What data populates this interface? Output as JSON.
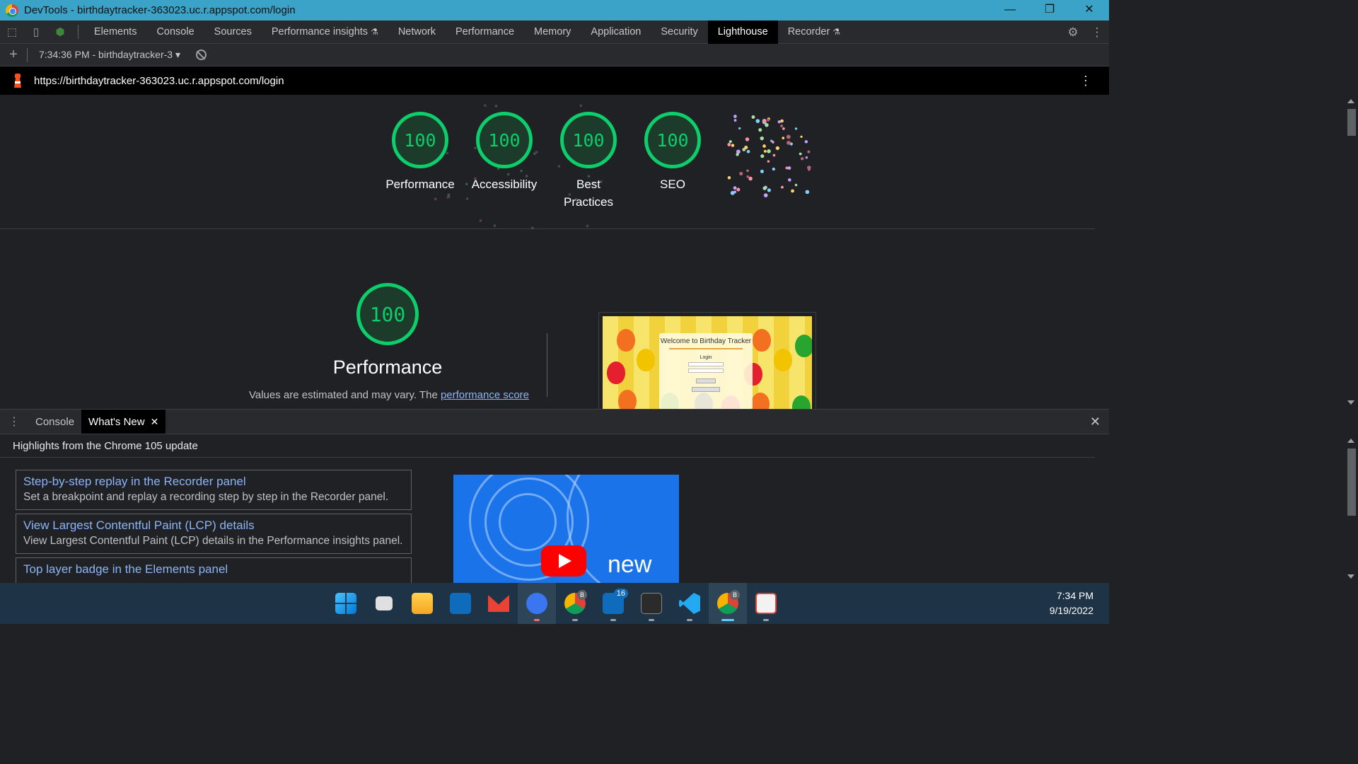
{
  "window": {
    "title": "DevTools - birthdaytracker-363023.uc.r.appspot.com/login"
  },
  "devtools_tabs": [
    {
      "label": "Elements",
      "experimental": false,
      "active": false
    },
    {
      "label": "Console",
      "experimental": false,
      "active": false
    },
    {
      "label": "Sources",
      "experimental": false,
      "active": false
    },
    {
      "label": "Performance insights",
      "experimental": true,
      "active": false
    },
    {
      "label": "Network",
      "experimental": false,
      "active": false
    },
    {
      "label": "Performance",
      "experimental": false,
      "active": false
    },
    {
      "label": "Memory",
      "experimental": false,
      "active": false
    },
    {
      "label": "Application",
      "experimental": false,
      "active": false
    },
    {
      "label": "Security",
      "experimental": false,
      "active": false
    },
    {
      "label": "Lighthouse",
      "experimental": false,
      "active": true
    },
    {
      "label": "Recorder",
      "experimental": true,
      "active": false
    }
  ],
  "lighthouse": {
    "report_select": "7:34:36 PM - birthdaytracker-3",
    "url": "https://birthdaytracker-363023.uc.r.appspot.com/login",
    "scores": [
      {
        "score": "100",
        "label": "Performance"
      },
      {
        "score": "100",
        "label": "Accessibility"
      },
      {
        "score": "100",
        "label": "Best Practices"
      },
      {
        "score": "100",
        "label": "SEO"
      }
    ],
    "perf": {
      "score": "100",
      "title": "Performance",
      "desc_prefix": "Values are estimated and may vary. The ",
      "desc_link": "performance score"
    },
    "screenshot": {
      "card_title": "Welcome to Birthday Tracker",
      "card_sub": "Login"
    }
  },
  "drawer": {
    "tabs": [
      {
        "label": "Console",
        "active": false
      },
      {
        "label": "What's New",
        "active": true
      }
    ],
    "highlights": "Highlights from the Chrome 105 update",
    "items": [
      {
        "title": "Step-by-step replay in the Recorder panel",
        "desc": "Set a breakpoint and replay a recording step by step in the Recorder panel."
      },
      {
        "title": "View Largest Contentful Paint (LCP) details",
        "desc": "View Largest Contentful Paint (LCP) details in the Performance insights panel."
      },
      {
        "title": "Top layer badge in the Elements panel",
        "desc": ""
      }
    ],
    "video_word": "new"
  },
  "taskbar": {
    "apps": [
      "start-icon",
      "task-view-icon",
      "file-explorer-icon",
      "outlook-icon",
      "gmail-icon",
      "signal-icon",
      "chrome-icon",
      "mail-icon",
      "terminal-icon",
      "vscode-icon",
      "chrome-active-icon",
      "snipping-tool-icon"
    ],
    "mail_badge": "16",
    "profile_badge": "B",
    "time": "7:34 PM",
    "date": "9/19/2022"
  },
  "colors": {
    "accent": "#0cce6b",
    "link": "#8ab4f8",
    "titlebar": "#3aa3c7"
  }
}
